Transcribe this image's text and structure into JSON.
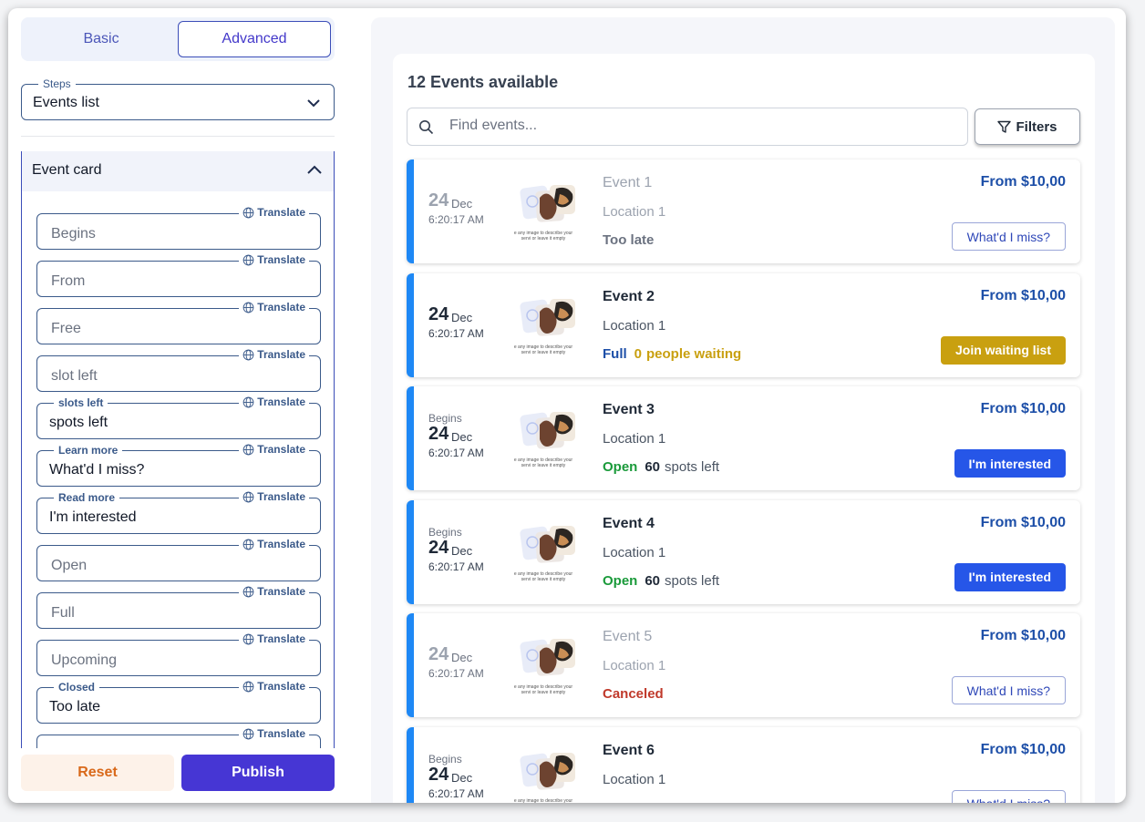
{
  "sidebar": {
    "tabs": {
      "basic": "Basic",
      "advanced": "Advanced"
    },
    "steps": {
      "legend": "Steps",
      "value": "Events list"
    },
    "section_title": "Event card",
    "translate_label": "Translate",
    "fields": [
      {
        "label": "",
        "value": "",
        "placeholder": "Begins"
      },
      {
        "label": "",
        "value": "",
        "placeholder": "From"
      },
      {
        "label": "",
        "value": "",
        "placeholder": "Free"
      },
      {
        "label": "",
        "value": "",
        "placeholder": "slot left"
      },
      {
        "label": "slots left",
        "value": "spots left",
        "placeholder": ""
      },
      {
        "label": "Learn more",
        "value": "What'd I miss?",
        "placeholder": ""
      },
      {
        "label": "Read more",
        "value": "I'm interested",
        "placeholder": ""
      },
      {
        "label": "",
        "value": "",
        "placeholder": "Open"
      },
      {
        "label": "",
        "value": "",
        "placeholder": "Full"
      },
      {
        "label": "",
        "value": "",
        "placeholder": "Upcoming"
      },
      {
        "label": "Closed",
        "value": "Too late",
        "placeholder": ""
      },
      {
        "label": "",
        "value": "",
        "placeholder": ""
      }
    ],
    "reset_label": "Reset",
    "publish_label": "Publish"
  },
  "events_panel": {
    "count_label": "12 Events available",
    "search_placeholder": "Find events...",
    "filters_label": "Filters",
    "image_placeholder_text": "e any image to describe your servi or leave it empty",
    "events": [
      {
        "name": "Event 1",
        "location": "Location 1",
        "begins": "",
        "day": "24",
        "month": "Dec",
        "time": "6:20:17 AM",
        "price": "From $10,00",
        "status": "Too late",
        "status_extra_num": "",
        "status_extra": "",
        "cta": "What'd I miss?",
        "cta_style": "outline",
        "faded": true,
        "status_color": "#6b7280"
      },
      {
        "name": "Event 2",
        "location": "Location 1",
        "begins": "",
        "day": "24",
        "month": "Dec",
        "time": "6:20:17 AM",
        "price": "From $10,00",
        "status": "Full",
        "status_extra_num": "0",
        "status_extra": "people waiting",
        "cta": "Join waiting list",
        "cta_style": "gold",
        "faded": false,
        "status_color": "#1d4fa8"
      },
      {
        "name": "Event 3",
        "location": "Location 1",
        "begins": "Begins",
        "day": "24",
        "month": "Dec",
        "time": "6:20:17 AM",
        "price": "From $10,00",
        "status": "Open",
        "status_extra_num": "60",
        "status_extra": "spots left",
        "cta": "I'm interested",
        "cta_style": "blue",
        "faded": false,
        "status_color": "#1a9a3a"
      },
      {
        "name": "Event 4",
        "location": "Location 1",
        "begins": "Begins",
        "day": "24",
        "month": "Dec",
        "time": "6:20:17 AM",
        "price": "From $10,00",
        "status": "Open",
        "status_extra_num": "60",
        "status_extra": "spots left",
        "cta": "I'm interested",
        "cta_style": "blue",
        "faded": false,
        "status_color": "#1a9a3a"
      },
      {
        "name": "Event 5",
        "location": "Location 1",
        "begins": "",
        "day": "24",
        "month": "Dec",
        "time": "6:20:17 AM",
        "price": "From $10,00",
        "status": "Canceled",
        "status_extra_num": "",
        "status_extra": "",
        "cta": "What'd I miss?",
        "cta_style": "outline",
        "faded": true,
        "status_color": "#c0392b"
      },
      {
        "name": "Event 6",
        "location": "Location 1",
        "begins": "Begins",
        "day": "24",
        "month": "Dec",
        "time": "6:20:17 AM",
        "price": "From $10,00",
        "status": "",
        "status_extra_num": "",
        "status_extra": "",
        "cta": "What'd I miss?",
        "cta_style": "outline",
        "faded": false,
        "status_color": "#6b7280"
      }
    ]
  },
  "colors": {
    "accent": "#4636d4",
    "card_stripe": "#1e88f5",
    "price": "#1d4fa8"
  }
}
